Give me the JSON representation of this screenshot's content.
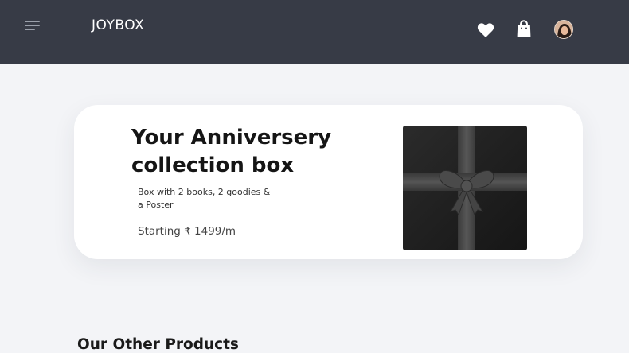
{
  "header": {
    "brand": "JOYBOX",
    "icons": {
      "menu": "hamburger-menu-icon",
      "wishlist": "heart-icon",
      "cart": "shopping-bag-icon",
      "profile": "user-avatar"
    }
  },
  "hero": {
    "title": "Your Anniversery collection box",
    "description": "Box with 2 books, 2 goodies & a Poster",
    "price": "Starting ₹ 1499/m",
    "image": "black-gift-box-with-ribbon"
  },
  "sections": {
    "other_products_title": "Our Other Products"
  },
  "colors": {
    "header_bg": "#373b46",
    "page_bg": "#f3f4f7",
    "card_bg": "#ffffff",
    "text_dark": "#151515"
  }
}
